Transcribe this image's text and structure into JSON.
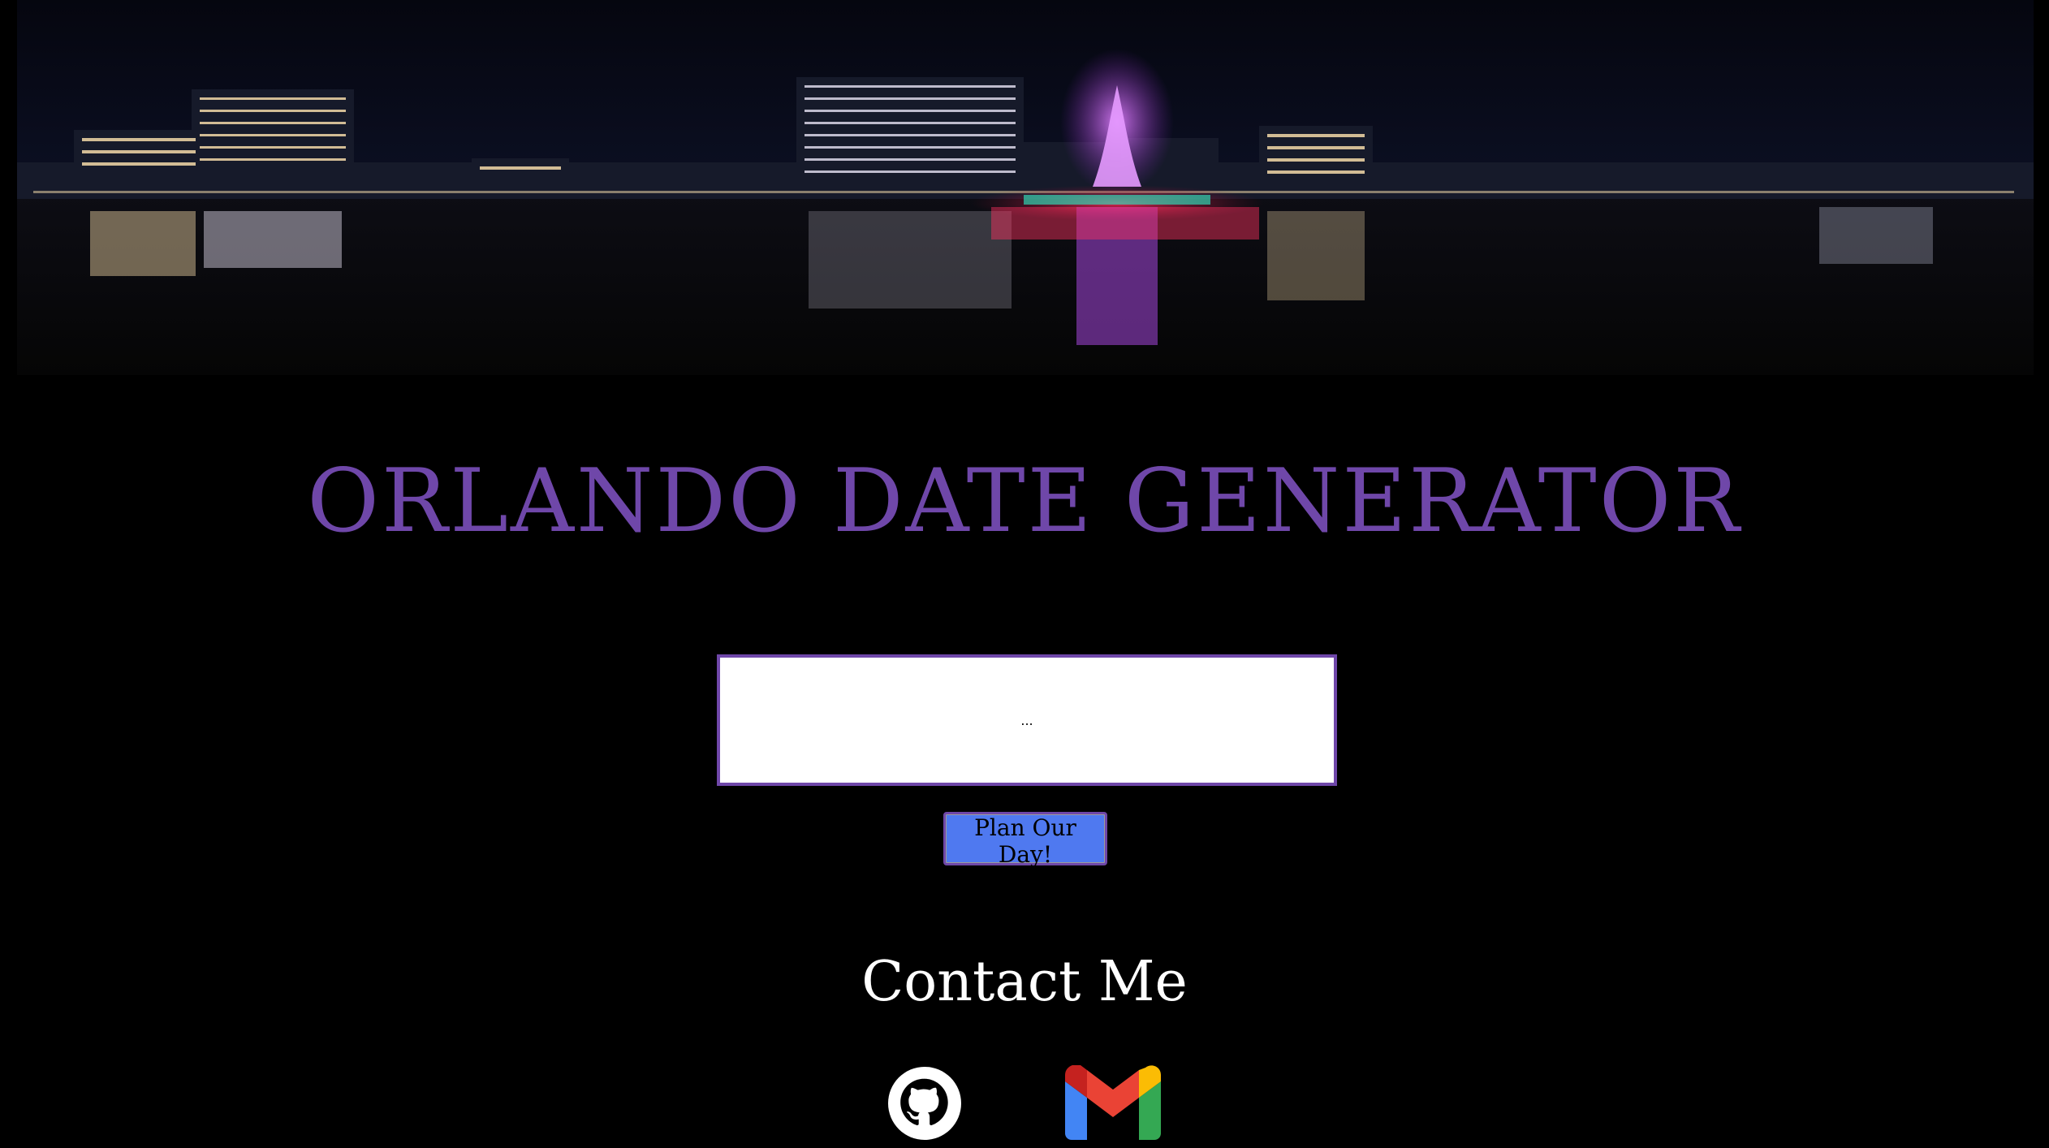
{
  "hero": {
    "image_description_icon": "orlando-skyline-night-image"
  },
  "title": "ORLANDO DATE GENERATOR",
  "output": {
    "text": "..."
  },
  "plan_button": {
    "label": "Plan Our Day!"
  },
  "contact": {
    "heading": "Contact Me",
    "links": [
      {
        "icon": "github-icon"
      },
      {
        "icon": "gmail-icon"
      }
    ]
  },
  "colors": {
    "background": "#000000",
    "title": "#6f47a9",
    "button": "#4f79f0",
    "box_border": "#6f47a9",
    "contact_text": "#ffffff"
  }
}
